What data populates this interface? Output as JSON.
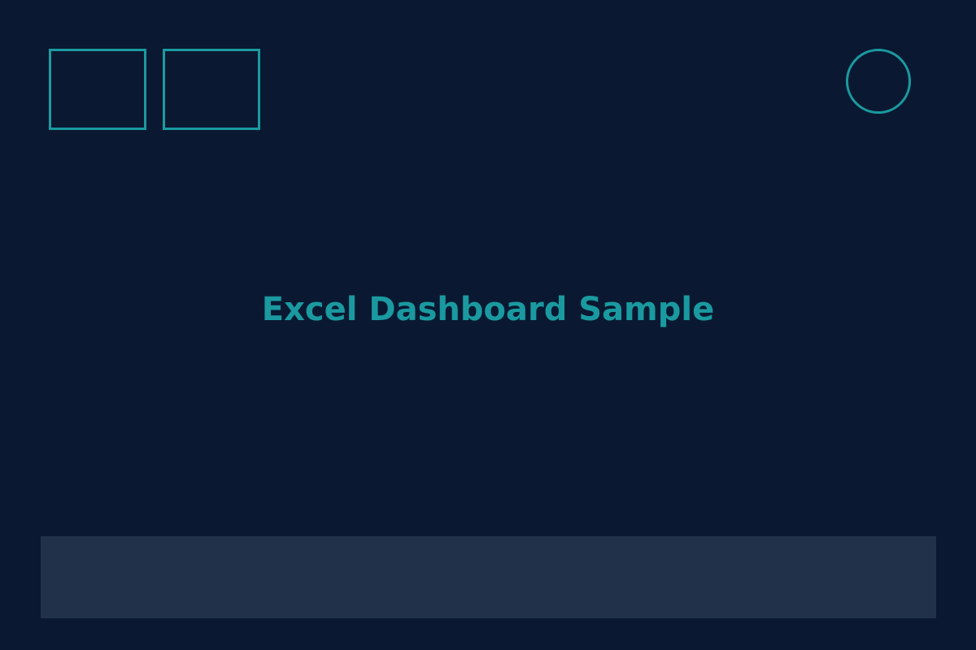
{
  "colors": {
    "background": "#0a1931",
    "accent": "#1a9aa0",
    "footer_bar": "#22314a"
  },
  "main": {
    "title": "Excel Dashboard Sample"
  }
}
